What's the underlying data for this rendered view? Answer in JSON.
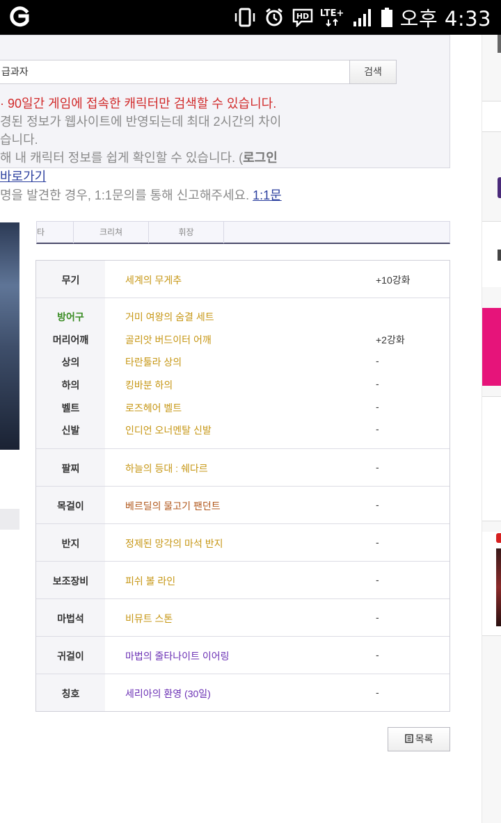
{
  "status_bar": {
    "time": "오후 4:33",
    "network": "LTE+",
    "hd_label": "HD"
  },
  "search": {
    "input_value": "급과자",
    "button_label": "검색"
  },
  "notice": {
    "line1": "· 90일간 게임에 접속한 캐릭터만 검색할 수 있습니다.",
    "line2": "경된 정보가 웹사이트에 반영되는데 최대 2시간의 차이",
    "line3": "습니다.",
    "line4_prefix": "해 내 캐릭터 정보를 쉽게 확인할 수 있습니다. (",
    "line4_strong": "로그인",
    "link_text": "바로가기",
    "report_text": "명을 발견한 경우, 1:1문의를 통해 신고해주세요. ",
    "report_link": "1:1문"
  },
  "tabs": [
    {
      "label": "타"
    },
    {
      "label": "크리쳐"
    },
    {
      "label": "휘장"
    }
  ],
  "equipment": {
    "weapon": {
      "label": "무기",
      "item": "세계의 무게추",
      "enhance": "+10강화"
    },
    "armor_group_label": "방어구",
    "armor_set": {
      "item": "거미 여왕의 숨결 세트"
    },
    "head_shoulder": {
      "label": "머리어깨",
      "item": "골리앗 버드이터 어깨",
      "enhance": "+2강화"
    },
    "top": {
      "label": "상의",
      "item": "타란툴라 상의",
      "enhance": "-"
    },
    "bottom": {
      "label": "하의",
      "item": "킹바분 하의",
      "enhance": "-"
    },
    "belt": {
      "label": "벨트",
      "item": "로즈헤어 벨트",
      "enhance": "-"
    },
    "shoes": {
      "label": "신발",
      "item": "인디언 오너멘탈 신발",
      "enhance": "-"
    },
    "bracelet": {
      "label": "팔찌",
      "item": "하늘의 등대 : 쉐다르",
      "enhance": "-"
    },
    "necklace": {
      "label": "목걸이",
      "item": "베르딜의 물고기 팬던트",
      "enhance": "-"
    },
    "ring": {
      "label": "반지",
      "item": "정제된 망각의 마석 반지",
      "enhance": "-"
    },
    "subweapon": {
      "label": "보조장비",
      "item": "피쉬 볼 라인",
      "enhance": "-"
    },
    "magicstone": {
      "label": "마법석",
      "item": "비뮤트 스톤",
      "enhance": "-"
    },
    "earring": {
      "label": "귀걸이",
      "item": "마법의 줄타나이트 이어링",
      "enhance": "-"
    },
    "title": {
      "label": "칭호",
      "item": "세리아의 환영 (30일)",
      "enhance": "-"
    }
  },
  "list_button": {
    "label": "목록"
  },
  "colors": {
    "item_gold": "#c69613",
    "item_brown": "#b0561a",
    "item_purple": "#6a2fb4",
    "notice_red": "#d12a2a",
    "link_blue": "#2b3f9e",
    "armor_green": "#3a8c24",
    "ad_pink": "#e6147a"
  }
}
